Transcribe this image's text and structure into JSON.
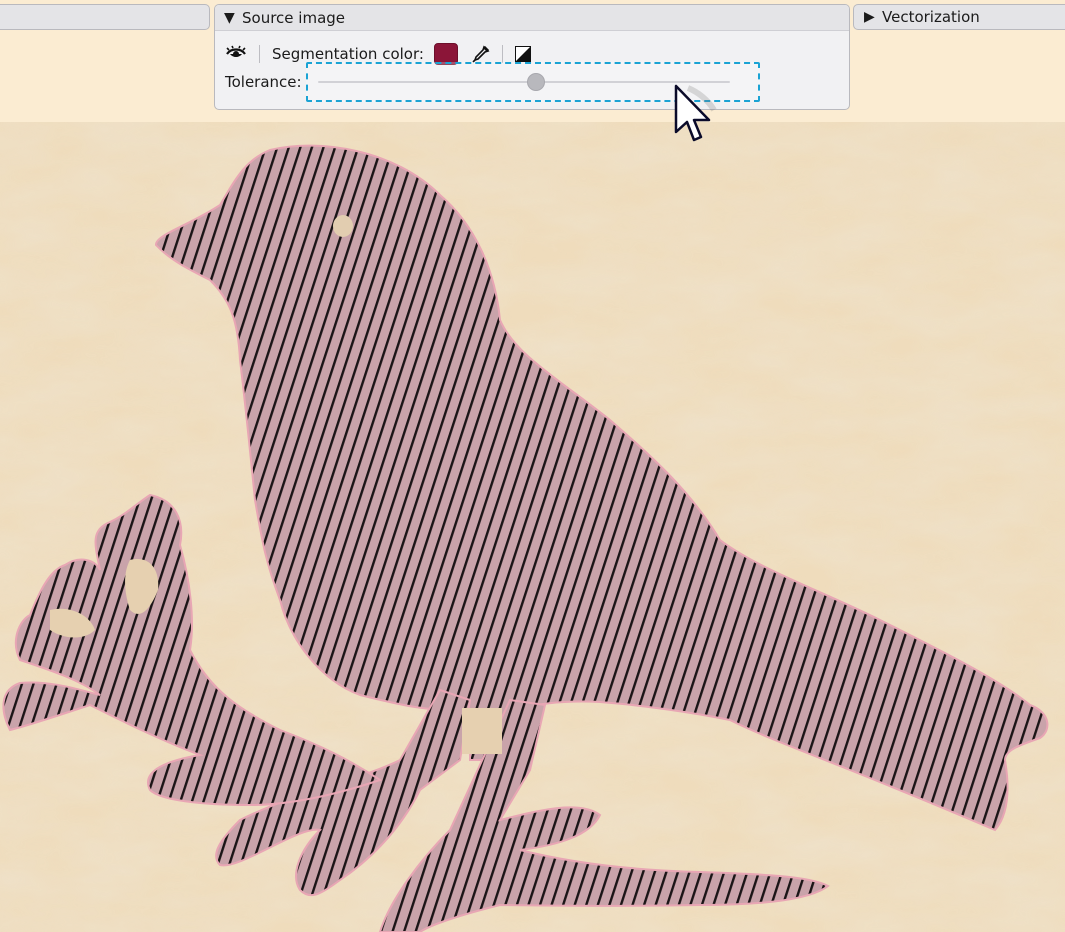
{
  "panels": {
    "source_image": {
      "title": "Source image",
      "expanded": true,
      "segmentation_color_label": "Segmentation color:",
      "segmentation_color": "#8b1538",
      "tolerance_label": "Tolerance:",
      "tolerance_value": 0.53
    },
    "vectorization": {
      "title": "Vectorization",
      "expanded": false
    }
  },
  "icons": {
    "visibility": "eye-icon",
    "picker": "eyedropper-icon",
    "invert": "invert-icon",
    "expanded_marker": "triangle-down-icon",
    "collapsed_marker": "triangle-right-icon"
  },
  "colors": {
    "background": "#fbecd2",
    "panel": "#f1f1f3",
    "highlight": "#1aa3d4",
    "segment_fill": "#c8a0a8",
    "segment_stripe": "#1a1416"
  }
}
